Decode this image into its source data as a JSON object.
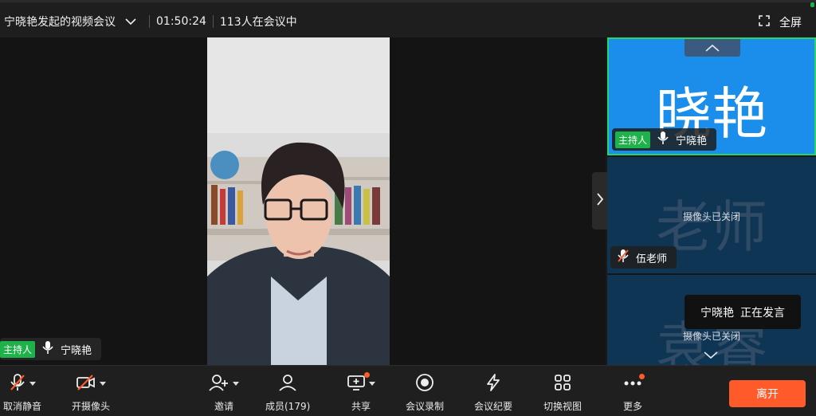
{
  "header": {
    "title": "宁晓艳发起的视频会议",
    "duration": "01:50:24",
    "participants_status": "113人在会议中",
    "fullscreen_label": "全屏"
  },
  "main_video": {
    "host_badge": "主持人",
    "speaker_name": "宁晓艳"
  },
  "sidebar": {
    "tiles": [
      {
        "avatar_text": "晓艳",
        "host_badge": "主持人",
        "name": "宁晓艳",
        "camera_status": ""
      },
      {
        "avatar_text": "老师",
        "name": "伍老师",
        "camera_status": "摄像头已关闭"
      },
      {
        "avatar_text": "袁睿",
        "name": "",
        "camera_status": "摄像头已关闭"
      }
    ]
  },
  "speaking_toast": {
    "name": "宁晓艳",
    "status": "正在发言"
  },
  "toolbar": {
    "unmute": "取消静音",
    "camera": "开摄像头",
    "invite": "邀请",
    "members": "成员(179)",
    "share": "共享",
    "record": "会议录制",
    "minutes": "会议纪要",
    "switch_view": "切换视图",
    "more": "更多",
    "leave": "离开"
  },
  "colors": {
    "accent_green": "#1fb24a",
    "leave_orange": "#ff5a2a",
    "active_tile_blue": "#1a8eea",
    "tile_navy": "#0f3555"
  }
}
